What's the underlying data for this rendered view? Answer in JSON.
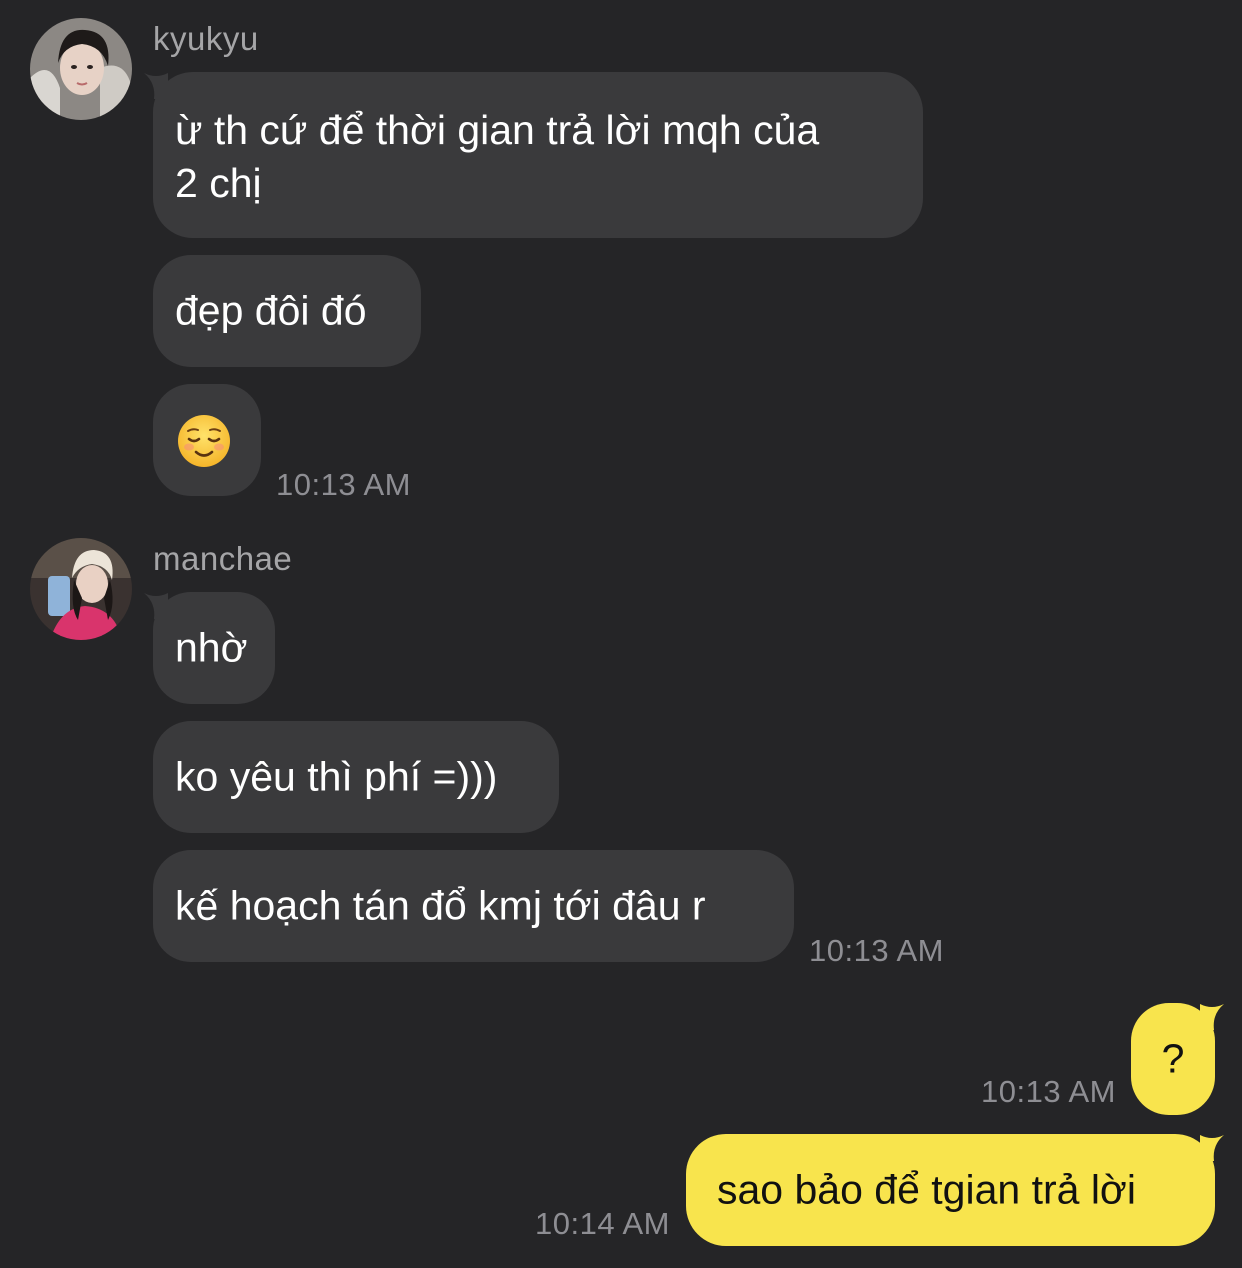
{
  "colors": {
    "background": "#252527",
    "incoming_bubble": "#3a3a3c",
    "outgoing_bubble": "#f8e44d",
    "incoming_text": "#ffffff",
    "outgoing_text": "#111111",
    "name_text": "#a5a5a7",
    "timestamp_text": "#8e8e93"
  },
  "groups": [
    {
      "sender": "kyukyu",
      "avatar_icon": "profile-photo",
      "messages": [
        "ừ th cứ để thời gian trả lời mqh của",
        "2 chị",
        "đẹp đôi đó",
        "😌"
      ],
      "emoji_name": "relieved-face-emoji",
      "time": "10:13 AM"
    },
    {
      "sender": "manchae",
      "avatar_icon": "profile-photo",
      "messages": [
        "nhờ",
        "ko yêu thì phí =)))",
        "kế hoạch tán đổ kmj tới đâu r"
      ],
      "time": "10:13 AM"
    }
  ],
  "outgoing": [
    {
      "text": "?",
      "time": "10:13 AM"
    },
    {
      "text": "sao bảo để tgian trả lời",
      "time": "10:14 AM"
    }
  ]
}
